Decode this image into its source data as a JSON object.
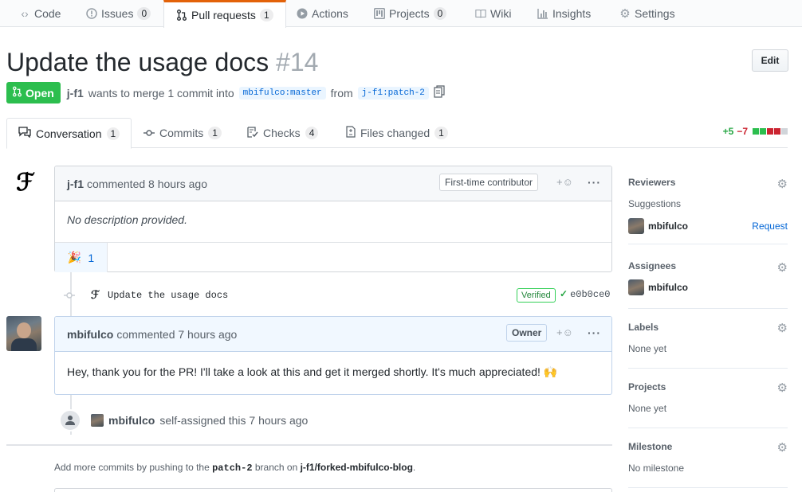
{
  "repo_nav": {
    "tabs": [
      {
        "label": "Code",
        "icon": "code-icon",
        "count": ""
      },
      {
        "label": "Issues",
        "icon": "issue-icon",
        "count": "0"
      },
      {
        "label": "Pull requests",
        "icon": "pull-request-icon",
        "count": "1"
      },
      {
        "label": "Actions",
        "icon": "play-icon",
        "count": ""
      },
      {
        "label": "Projects",
        "icon": "project-icon",
        "count": "0"
      },
      {
        "label": "Wiki",
        "icon": "book-icon",
        "count": ""
      },
      {
        "label": "Insights",
        "icon": "graph-icon",
        "count": ""
      },
      {
        "label": "Settings",
        "icon": "gear-icon",
        "count": ""
      }
    ]
  },
  "pr": {
    "title": "Update the usage docs",
    "number": "#14",
    "edit_label": "Edit",
    "state": "Open",
    "author": "j-f1",
    "summary_middle": "wants to merge 1 commit into",
    "base_branch": "mbifulco:master",
    "from_word": "from",
    "head_branch": "j-f1:patch-2"
  },
  "pr_tabs": [
    {
      "label": "Conversation",
      "count": "1",
      "icon": "comment-icon"
    },
    {
      "label": "Commits",
      "count": "1",
      "icon": "commit-icon"
    },
    {
      "label": "Checks",
      "count": "4",
      "icon": "checklist-icon"
    },
    {
      "label": "Files changed",
      "count": "1",
      "icon": "file-diff-icon"
    }
  ],
  "diffstat": {
    "additions": "+5",
    "deletions": "−7",
    "colors": [
      "#2cbe4e",
      "#2cbe4e",
      "#cb2431",
      "#cb2431",
      "#d1d5da"
    ]
  },
  "comment1": {
    "author": "j-f1",
    "meta": "commented 8 hours ago",
    "badge": "First-time contributor",
    "body": "No description provided.",
    "reaction_emoji": "🎉",
    "reaction_count": "1"
  },
  "commit": {
    "message": "Update the usage docs",
    "verified": "Verified",
    "sha": "e0b0ce0"
  },
  "comment2": {
    "author": "mbifulco",
    "meta": "commented 7 hours ago",
    "badge": "Owner",
    "body": "Hey, thank you for the PR! I'll take a look at this and get it merged shortly. It's much appreciated! 🙌"
  },
  "event": {
    "actor": "mbifulco",
    "text": "self-assigned this 7 hours ago"
  },
  "merge_note": {
    "prefix": "Add more commits by pushing to the",
    "branch": "patch-2",
    "middle": "branch on",
    "repo": "j-f1/forked-mbifulco-blog",
    "suffix": "."
  },
  "sidebar": {
    "reviewers": {
      "heading": "Reviewers",
      "suggestions": "Suggestions",
      "user": "mbifulco",
      "request": "Request"
    },
    "assignees": {
      "heading": "Assignees",
      "user": "mbifulco"
    },
    "labels": {
      "heading": "Labels",
      "value": "None yet"
    },
    "projects": {
      "heading": "Projects",
      "value": "None yet"
    },
    "milestone": {
      "heading": "Milestone",
      "value": "No milestone"
    }
  }
}
